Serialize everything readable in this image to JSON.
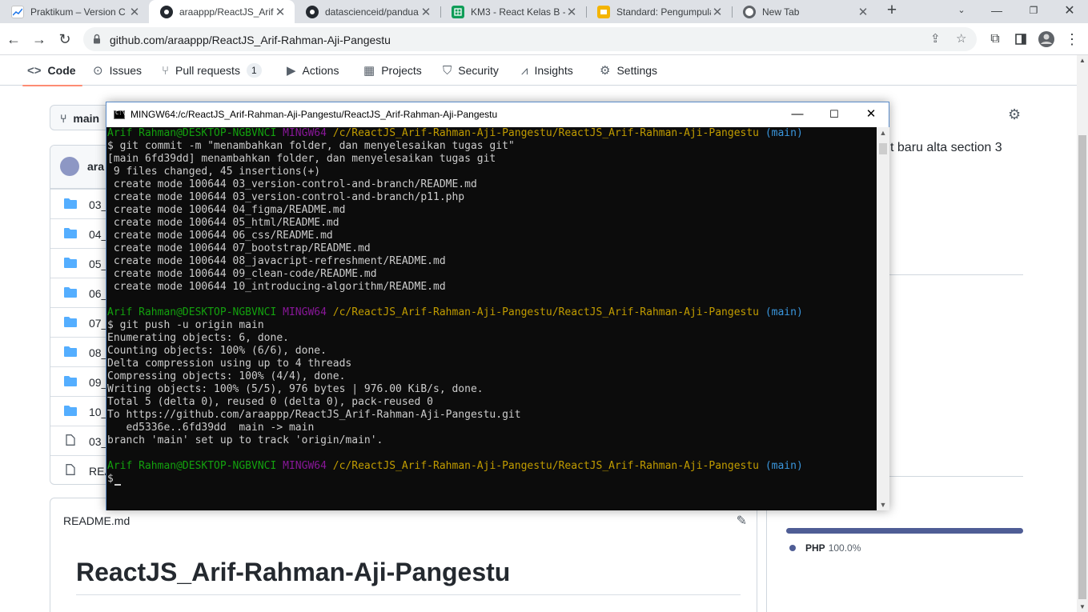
{
  "browser": {
    "tabs": [
      {
        "title": "Praktikum – Version C",
        "favicon": "slides-chart-icon",
        "active": false
      },
      {
        "title": "araappp/ReactJS_Arif-",
        "favicon": "github-icon",
        "active": true
      },
      {
        "title": "datascienceid/pandua",
        "favicon": "github-icon",
        "active": false
      },
      {
        "title": "KM3 - React Kelas B -",
        "favicon": "sheets-icon",
        "active": false
      },
      {
        "title": "Standard: Pengumpula",
        "favicon": "slides-icon",
        "active": false
      },
      {
        "title": "New Tab",
        "favicon": "chrome-icon",
        "active": false
      }
    ],
    "url": "github.com/araappp/ReactJS_Arif-Rahman-Aji-Pangestu"
  },
  "repo": {
    "nav": [
      {
        "label": "Code",
        "icon": "code-icon"
      },
      {
        "label": "Issues",
        "icon": "issue-icon"
      },
      {
        "label": "Pull requests",
        "icon": "pull-request-icon",
        "count": "1"
      },
      {
        "label": "Actions",
        "icon": "play-icon"
      },
      {
        "label": "Projects",
        "icon": "table-icon"
      },
      {
        "label": "Security",
        "icon": "shield-icon"
      },
      {
        "label": "Insights",
        "icon": "graph-icon"
      },
      {
        "label": "Settings",
        "icon": "gear-icon"
      }
    ],
    "branch": "main",
    "commit_author": "ara",
    "files": [
      {
        "name": "03_",
        "type": "folder"
      },
      {
        "name": "04_",
        "type": "folder"
      },
      {
        "name": "05_",
        "type": "folder"
      },
      {
        "name": "06_",
        "type": "folder"
      },
      {
        "name": "07_",
        "type": "folder"
      },
      {
        "name": "08_",
        "type": "folder"
      },
      {
        "name": "09_",
        "type": "folder"
      },
      {
        "name": "10_",
        "type": "folder"
      },
      {
        "name": "03_",
        "type": "file"
      },
      {
        "name": "REA",
        "type": "file"
      }
    ],
    "readme": {
      "filename": "README.md",
      "heading": "ReactJS_Arif-Rahman-Aji-Pangestu"
    },
    "about": {
      "description_fragment": "t baru alta section 3",
      "link_fragment": "e"
    },
    "languages": [
      {
        "name": "PHP",
        "percent": "100.0%",
        "color": "#4f5d95"
      }
    ]
  },
  "terminal": {
    "title": "MINGW64:/c/ReactJS_Arif-Rahman-Aji-Pangestu/ReactJS_Arif-Rahman-Aji-Pangestu",
    "prompt": {
      "user": "Arif Rahman@DESKTOP-NGBVNCI",
      "env": "MINGW64",
      "path": "/c/ReactJS_Arif-Rahman-Aji-Pangestu/ReactJS_Arif-Rahman-Aji-Pangestu",
      "branch": "(main)"
    },
    "lines": [
      {
        "kind": "prompt"
      },
      {
        "kind": "text",
        "text": "$ git commit -m \"menambahkan folder, dan menyelesaikan tugas git\""
      },
      {
        "kind": "text",
        "text": "[main 6fd39dd] menambahkan folder, dan menyelesaikan tugas git"
      },
      {
        "kind": "text",
        "text": " 9 files changed, 45 insertions(+)"
      },
      {
        "kind": "text",
        "text": " create mode 100644 03_version-control-and-branch/README.md"
      },
      {
        "kind": "text",
        "text": " create mode 100644 03_version-control-and-branch/p11.php"
      },
      {
        "kind": "text",
        "text": " create mode 100644 04_figma/README.md"
      },
      {
        "kind": "text",
        "text": " create mode 100644 05_html/README.md"
      },
      {
        "kind": "text",
        "text": " create mode 100644 06_css/README.md"
      },
      {
        "kind": "text",
        "text": " create mode 100644 07_bootstrap/README.md"
      },
      {
        "kind": "text",
        "text": " create mode 100644 08_javacript-refreshment/README.md"
      },
      {
        "kind": "text",
        "text": " create mode 100644 09_clean-code/README.md"
      },
      {
        "kind": "text",
        "text": " create mode 100644 10_introducing-algorithm/README.md"
      },
      {
        "kind": "text",
        "text": ""
      },
      {
        "kind": "prompt"
      },
      {
        "kind": "text",
        "text": "$ git push -u origin main"
      },
      {
        "kind": "text",
        "text": "Enumerating objects: 6, done."
      },
      {
        "kind": "text",
        "text": "Counting objects: 100% (6/6), done."
      },
      {
        "kind": "text",
        "text": "Delta compression using up to 4 threads"
      },
      {
        "kind": "text",
        "text": "Compressing objects: 100% (4/4), done."
      },
      {
        "kind": "text",
        "text": "Writing objects: 100% (5/5), 976 bytes | 976.00 KiB/s, done."
      },
      {
        "kind": "text",
        "text": "Total 5 (delta 0), reused 0 (delta 0), pack-reused 0"
      },
      {
        "kind": "text",
        "text": "To https://github.com/araappp/ReactJS_Arif-Rahman-Aji-Pangestu.git"
      },
      {
        "kind": "text",
        "text": "   ed5336e..6fd39dd  main -> main"
      },
      {
        "kind": "text",
        "text": "branch 'main' set up to track 'origin/main'."
      },
      {
        "kind": "text",
        "text": ""
      },
      {
        "kind": "prompt"
      },
      {
        "kind": "text",
        "text": "$"
      }
    ]
  }
}
